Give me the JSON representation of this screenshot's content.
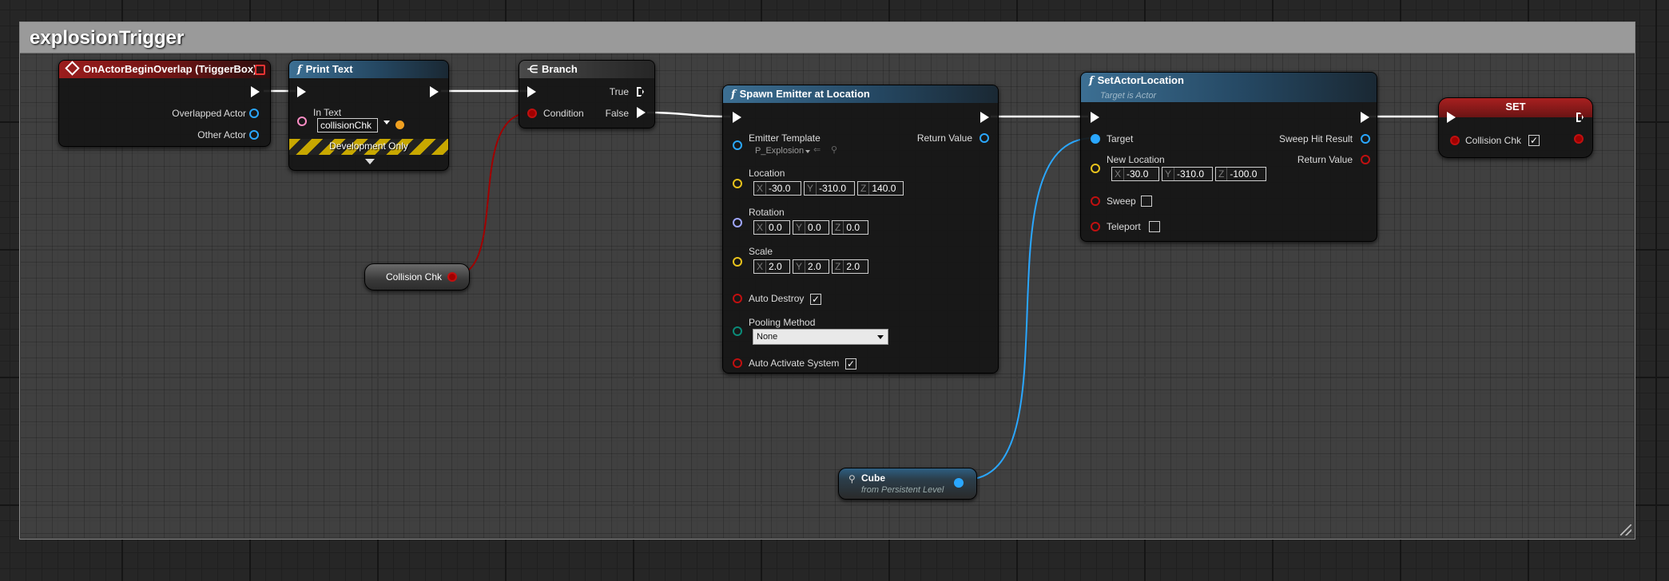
{
  "comment": {
    "title": "explosionTrigger"
  },
  "nodes": {
    "event": {
      "title": "OnActorBeginOverlap (TriggerBox)",
      "pins": [
        "Overlapped Actor",
        "Other Actor"
      ]
    },
    "print_text": {
      "title": "Print Text",
      "in_text_label": "In Text",
      "in_text_value": "collisionChk",
      "dev_only": "Development Only"
    },
    "branch": {
      "title": "Branch",
      "true_label": "True",
      "false_label": "False",
      "condition_label": "Condition"
    },
    "spawn_emitter": {
      "title": "Spawn Emitter at Location",
      "emitter_label": "Emitter Template",
      "emitter_value": "P_Explosion",
      "return_label": "Return Value",
      "location_label": "Location",
      "location": {
        "x": "-30.0",
        "y": "-310.0",
        "z": "140.0"
      },
      "rotation_label": "Rotation",
      "rotation": {
        "x": "0.0",
        "y": "0.0",
        "z": "0.0"
      },
      "scale_label": "Scale",
      "scale": {
        "x": "2.0",
        "y": "2.0",
        "z": "2.0"
      },
      "auto_destroy_label": "Auto Destroy",
      "pooling_label": "Pooling Method",
      "pooling_value": "None",
      "auto_activate_label": "Auto Activate System"
    },
    "set_actor_location": {
      "title": "SetActorLocation",
      "subtitle": "Target is Actor",
      "target_label": "Target",
      "sweep_hit_label": "Sweep Hit Result",
      "new_location_label": "New Location",
      "return_label": "Return Value",
      "new_location": {
        "x": "-30.0",
        "y": "-310.0",
        "z": "-100.0"
      },
      "sweep_label": "Sweep",
      "teleport_label": "Teleport"
    },
    "set_var": {
      "title": "SET",
      "pin_label": "Collision Chk"
    },
    "collision_get": {
      "label": "Collision Chk"
    },
    "cube_ref": {
      "title": "Cube",
      "subtitle": "from Persistent Level"
    }
  },
  "axis_labels": {
    "x": "X",
    "y": "Y",
    "z": "Z"
  },
  "colors": {
    "exec": "#ffffff",
    "object_pin": "#2aa7ff",
    "bool_pin": "#a10000",
    "vector_pin": "#e8c21c",
    "rotator_pin": "#9fa6ff",
    "enum_pin": "#0b8a78",
    "text_pin": "#ff8ec6"
  }
}
